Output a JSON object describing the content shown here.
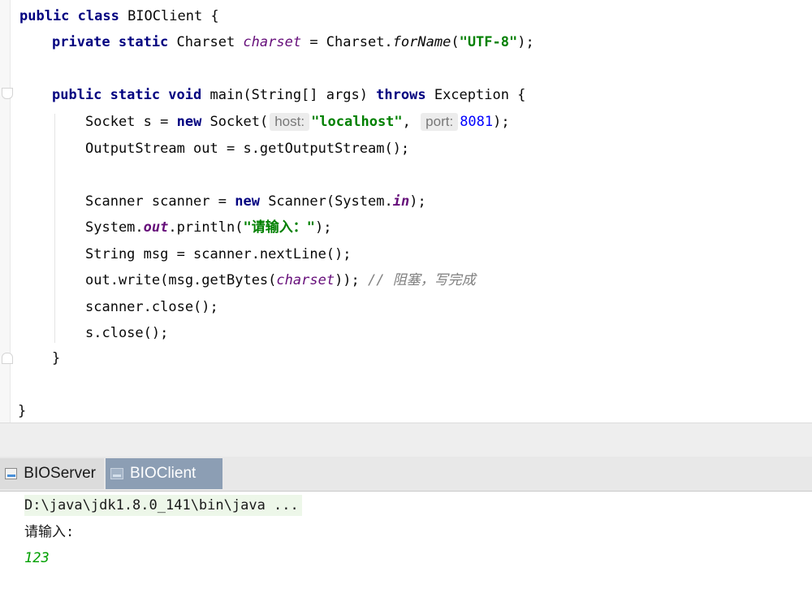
{
  "editor": {
    "lines": [
      {
        "kw1": "public class ",
        "rest": "BIOClient {"
      },
      {
        "kw1": "private static ",
        "p1": "Charset ",
        "field": "charset",
        "p2": " = Charset.",
        "static": "forName",
        "p3": "(",
        "str": "\"UTF-8\"",
        "p4": ");"
      },
      {
        "kw1": "public static void ",
        "p1": "main(String[] args) ",
        "kw2": "throws ",
        "p2": "Exception {"
      },
      {
        "p1": "Socket s = ",
        "kw1": "new ",
        "p2": "Socket(",
        "hint_host": "host:",
        "str": "\"localhost\"",
        "p3": ",",
        "hint_port": "port:",
        "num": "8081",
        "p4": ");"
      },
      {
        "p1": "OutputStream out = s.getOutputStream();"
      },
      {
        "p1": "Scanner scanner = ",
        "kw1": "new ",
        "p2": "Scanner(System.",
        "field": "in",
        "p3": ");"
      },
      {
        "p1": "System.",
        "field": "out",
        "p2": ".println(",
        "str": "\"请输入：\"",
        "p3": ");"
      },
      {
        "p1": "String msg = scanner.nextLine();"
      },
      {
        "p1": "out.write(msg.getBytes(",
        "field": "charset",
        "p2": ")); ",
        "comment": "// 阻塞，写完成"
      },
      {
        "p1": "scanner.close();"
      },
      {
        "p1": "s.close();"
      },
      {
        "p1": "}"
      },
      {
        "p1": "}"
      }
    ]
  },
  "tabs": [
    {
      "label": "BIOServer",
      "icon": "run-config-icon"
    },
    {
      "label": "BIOClient",
      "icon": "run-config-icon"
    }
  ],
  "console": {
    "command": "D:\\java\\jdk1.8.0_141\\bin\\java ...",
    "prompt": "请输入:",
    "input": "123"
  },
  "colors": {
    "keyword": "#000080",
    "field": "#660e7a",
    "string": "#008000",
    "number": "#0000ff",
    "comment": "#808080",
    "active_tab": "#8c9eb4",
    "console_input": "#00a000"
  }
}
